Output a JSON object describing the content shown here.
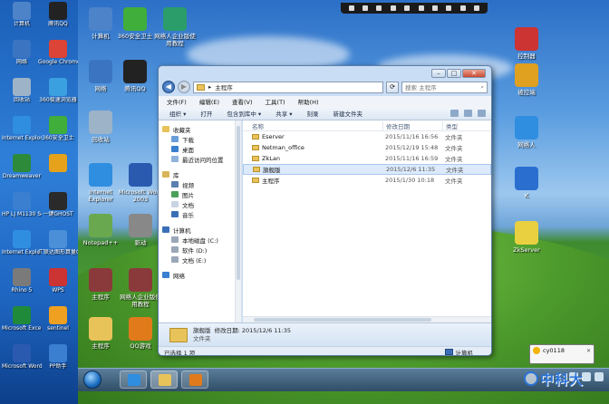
{
  "outer_desktop": {
    "icons": [
      {
        "label": "计算机",
        "color": "#4d83c9"
      },
      {
        "label": "腾讯QQ",
        "color": "#222222"
      },
      {
        "label": "网络",
        "color": "#3b75c2"
      },
      {
        "label": "Google Chrome",
        "color": "#db4437"
      },
      {
        "label": "回收站",
        "color": "#9db3c8"
      },
      {
        "label": "360极速浏览器",
        "color": "#3aa0e0"
      },
      {
        "label": "Internet Explorer",
        "color": "#2f8ee0"
      },
      {
        "label": "360安全卫士",
        "color": "#3fae3a"
      },
      {
        "label": "Dreamweaver",
        "color": "#2c8a3a"
      },
      {
        "label": "",
        "color": "#e6a21a"
      },
      {
        "label": "HP LJ M1130 Scan",
        "color": "#3a7fd0"
      },
      {
        "label": "一键GHOST",
        "color": "#2a2a2a"
      },
      {
        "label": "Internet Explorer",
        "color": "#2f8ee0"
      },
      {
        "label": "广联达图形算量GCL2013",
        "color": "#4a8fd8"
      },
      {
        "label": "Rhino 5",
        "color": "#7a7a7a"
      },
      {
        "label": "WPS",
        "color": "#cc3333"
      },
      {
        "label": "Microsoft Excel 2003",
        "color": "#1f8a3a"
      },
      {
        "label": "sentinel",
        "color": "#f0a020"
      },
      {
        "label": "Microsoft Word 2003",
        "color": "#2a5ab0"
      },
      {
        "label": "PP助手",
        "color": "#3a7fd0"
      }
    ]
  },
  "remote_desktop": {
    "icons_left": [
      {
        "label": "计算机",
        "color": "#4d83c9"
      },
      {
        "label": "360安全卫士",
        "color": "#3fae3a"
      },
      {
        "label": "网络人企业版使用教程",
        "color": "#2a9d6a"
      },
      {
        "label": "网络",
        "color": "#3b75c2"
      },
      {
        "label": "腾讯QQ",
        "color": "#222222"
      },
      {
        "label": "回收站",
        "color": "#9db3c8"
      },
      {
        "label": "Internet Explorer",
        "color": "#2f8ee0"
      },
      {
        "label": "Microsoft Word 2003",
        "color": "#2a5ab0"
      },
      {
        "label": "Notepad++",
        "color": "#6aa84f"
      },
      {
        "label": "驱动",
        "color": "#888888"
      },
      {
        "label": "主程序",
        "color": "#8a3a3a"
      },
      {
        "label": "网络人企业版使用教程",
        "color": "#8a3a3a"
      },
      {
        "label": "主程序",
        "color": "#e8c35a"
      },
      {
        "label": "QQ游戏",
        "color": "#e07a1a"
      }
    ],
    "icons_right": [
      {
        "label": "控制器",
        "color": "#cc3333"
      },
      {
        "label": "被控端",
        "color": "#e0a020"
      },
      {
        "label": "网络人",
        "color": "#2f8ee0"
      },
      {
        "label": "K",
        "color": "#2a6fd0"
      },
      {
        "label": "ZkServer",
        "color": "#e8d040"
      }
    ]
  },
  "explorer": {
    "address_path": "主程序",
    "search_placeholder": "搜索 主程序",
    "menu": [
      "文件(F)",
      "编辑(E)",
      "查看(V)",
      "工具(T)",
      "帮助(H)"
    ],
    "commands": [
      "组织 ▾",
      "打开",
      "包含到库中 ▾",
      "共享 ▾",
      "刻录",
      "新建文件夹"
    ],
    "sidebar": {
      "favorites": {
        "header": "收藏夹",
        "items": [
          "下载",
          "桌面",
          "最近访问的位置"
        ]
      },
      "library": {
        "header": "库",
        "items": [
          "视频",
          "图片",
          "文档",
          "音乐"
        ]
      },
      "computer": {
        "header": "计算机",
        "items": [
          "本地磁盘 (C:)",
          "软件 (D:)",
          "文档 (E:)"
        ]
      },
      "network": {
        "header": "网络"
      }
    },
    "columns": [
      "名称",
      "修改日期",
      "类型"
    ],
    "files": [
      {
        "name": "Eserver",
        "date": "2015/11/16 16:56",
        "type": "文件夹",
        "selected": false
      },
      {
        "name": "Netman_office",
        "date": "2015/12/19 15:48",
        "type": "文件夹",
        "selected": false
      },
      {
        "name": "ZkLan",
        "date": "2015/11/16 16:59",
        "type": "文件夹",
        "selected": false
      },
      {
        "name": "旗舰版",
        "date": "2015/12/6 11:35",
        "type": "文件夹",
        "selected": true
      },
      {
        "name": "主程序",
        "date": "2015/1/30 10:18",
        "type": "文件夹",
        "selected": false
      }
    ],
    "details": {
      "name": "旗舰版",
      "modified_label": "修改日期: 2015/12/6 11:35",
      "type": "文件夹"
    },
    "status": {
      "selected": "已选择 1 项",
      "location": "计算机"
    }
  },
  "qq_notify": {
    "user": "cy0118"
  },
  "watermark": "中科大"
}
